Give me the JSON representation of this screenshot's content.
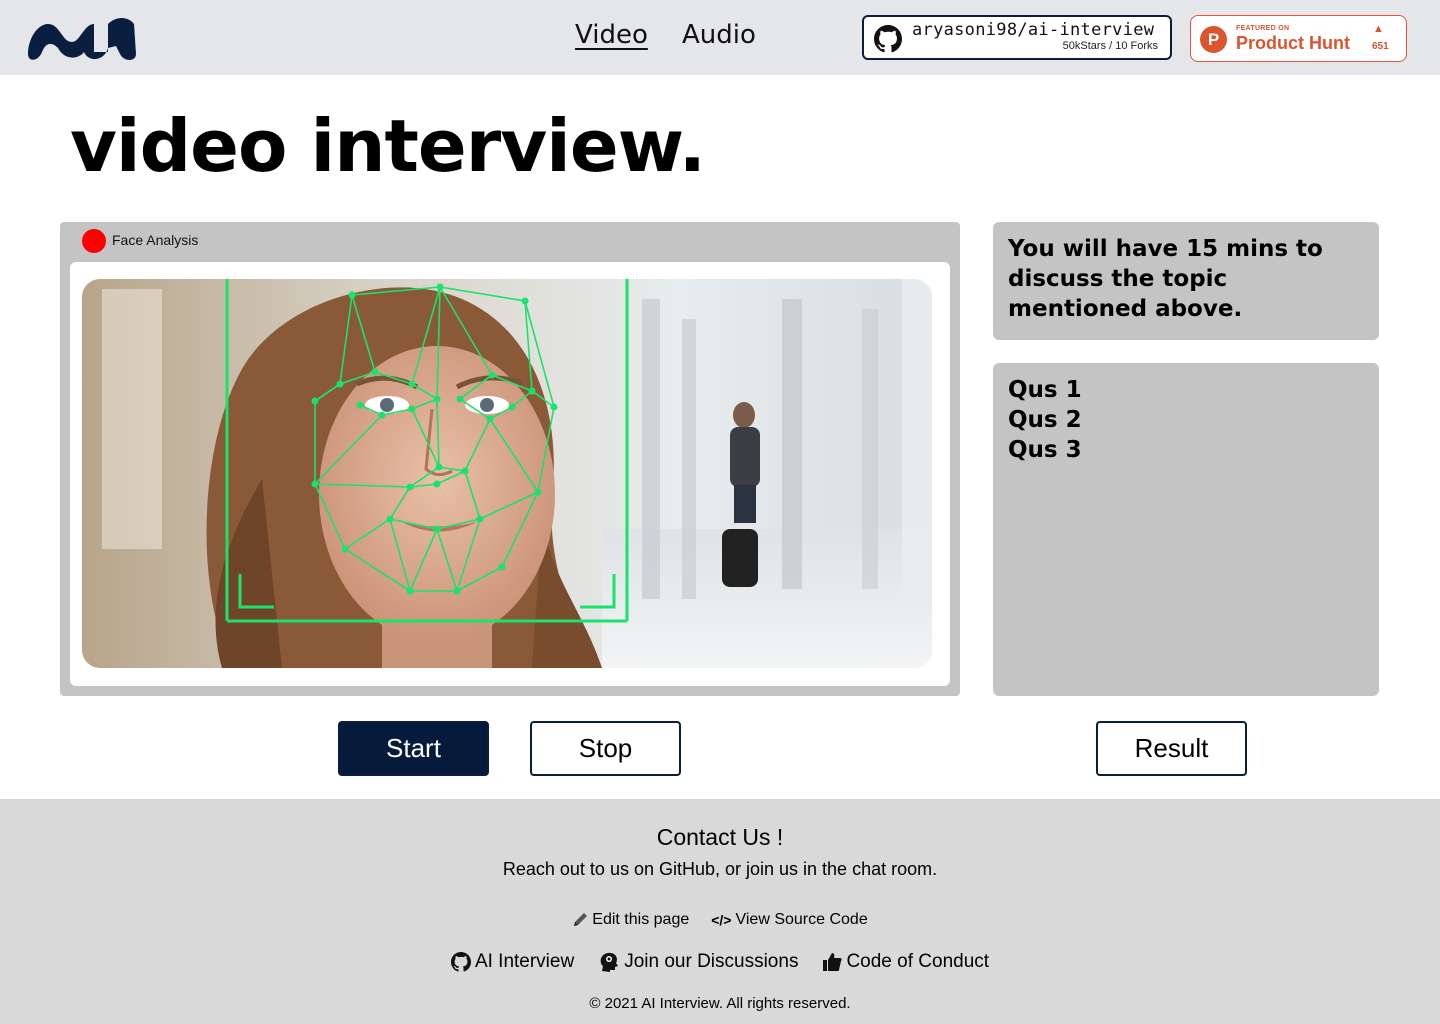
{
  "header": {
    "nav": {
      "video": "Video",
      "audio": "Audio"
    },
    "github_badge": {
      "repo": "aryasoni98/ai-interview",
      "stats": "50kStars / 10 Forks"
    },
    "producthunt_badge": {
      "featured": "FEATURED ON",
      "name": "Product Hunt",
      "votes": "651"
    }
  },
  "page_title": "video interview.",
  "video_panel": {
    "label": "Face Analysis",
    "recording_color": "#ff0000"
  },
  "info_text": "You will have 15 mins to discuss the topic mentioned above.",
  "questions": [
    "Qus 1",
    "Qus 2",
    "Qus 3"
  ],
  "buttons": {
    "start": "Start",
    "stop": "Stop",
    "result": "Result"
  },
  "footer": {
    "title": "Contact Us !",
    "subtitle": "Reach out to us on GitHub, or join us in the chat room.",
    "edit_page": "Edit this page",
    "view_source": "View Source Code",
    "ai_interview": "AI Interview",
    "discussions": "Join our Discussions",
    "conduct": "Code of Conduct",
    "copyright": "© 2021 AI Interview. All rights reserved."
  },
  "colors": {
    "primary": "#061b3b",
    "panel": "#c4c4c4",
    "header_bg": "#e4e6ea",
    "footer_bg": "#d9d9d9",
    "mesh": "#19e36a",
    "producthunt": "#da552f"
  }
}
